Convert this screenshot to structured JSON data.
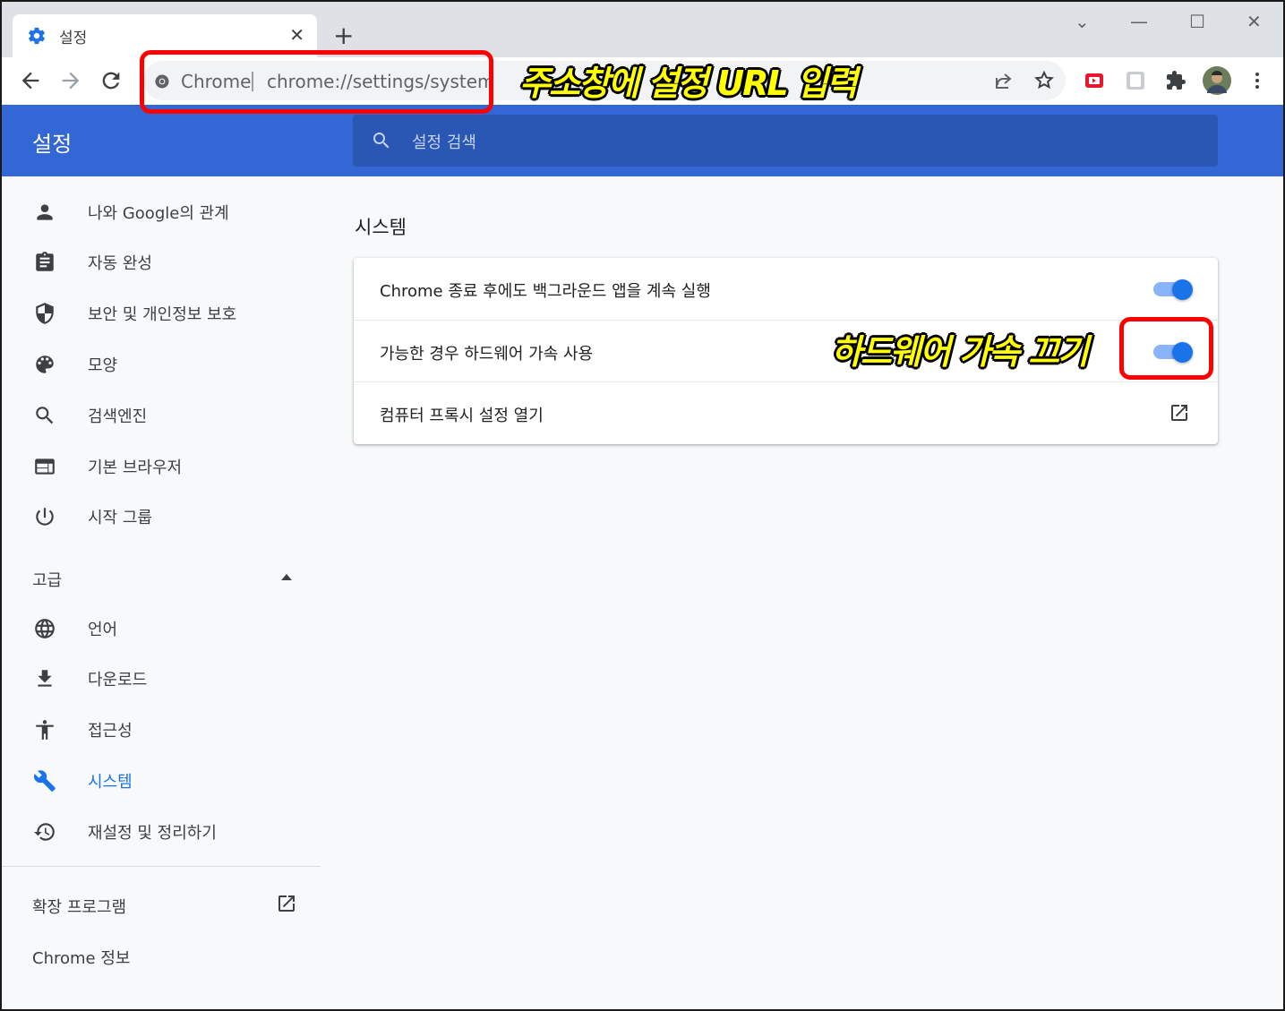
{
  "tab": {
    "title": "설정",
    "close_glyph": "✕"
  },
  "newtab_glyph": "+",
  "window_controls": {
    "minimize": "—",
    "maximize": "☐",
    "close": "✕",
    "dropdown": "⌄"
  },
  "omnibox": {
    "scheme_label": "Chrome",
    "url": "chrome://settings/system"
  },
  "header": {
    "title": "설정",
    "search_placeholder": "설정 검색"
  },
  "sidebar": {
    "items": [
      {
        "label": "나와 Google의 관계",
        "icon": "person-icon"
      },
      {
        "label": "자동 완성",
        "icon": "clipboard-icon"
      },
      {
        "label": "보안 및 개인정보 보호",
        "icon": "shield-icon"
      },
      {
        "label": "모양",
        "icon": "palette-icon"
      },
      {
        "label": "검색엔진",
        "icon": "search-icon"
      },
      {
        "label": "기본 브라우저",
        "icon": "browser-icon"
      },
      {
        "label": "시작 그룹",
        "icon": "power-icon"
      }
    ],
    "advanced_label": "고급",
    "advanced_items": [
      {
        "label": "언어",
        "icon": "globe-icon"
      },
      {
        "label": "다운로드",
        "icon": "download-icon"
      },
      {
        "label": "접근성",
        "icon": "accessibility-icon"
      },
      {
        "label": "시스템",
        "icon": "wrench-icon"
      },
      {
        "label": "재설정 및 정리하기",
        "icon": "history-icon"
      }
    ],
    "extensions_label": "확장 프로그램",
    "about_label": "Chrome 정보"
  },
  "content": {
    "section_title": "시스템",
    "rows": [
      {
        "label": "Chrome 종료 후에도 백그라운드 앱을 계속 실행",
        "toggle_on": true
      },
      {
        "label": "가능한 경우 하드웨어 가속 사용",
        "toggle_on": true
      },
      {
        "label": "컴퓨터 프록시 설정 열기"
      }
    ]
  },
  "annotations": {
    "address_note": "주소창에 설정 URL 입력",
    "toggle_note": "하드웨어 가속 끄기",
    "color": "#ff0000",
    "text_color": "#ffff00"
  },
  "colors": {
    "header": "#3367d6",
    "accent": "#1a73e8",
    "search_bg": "#2a56b4"
  }
}
